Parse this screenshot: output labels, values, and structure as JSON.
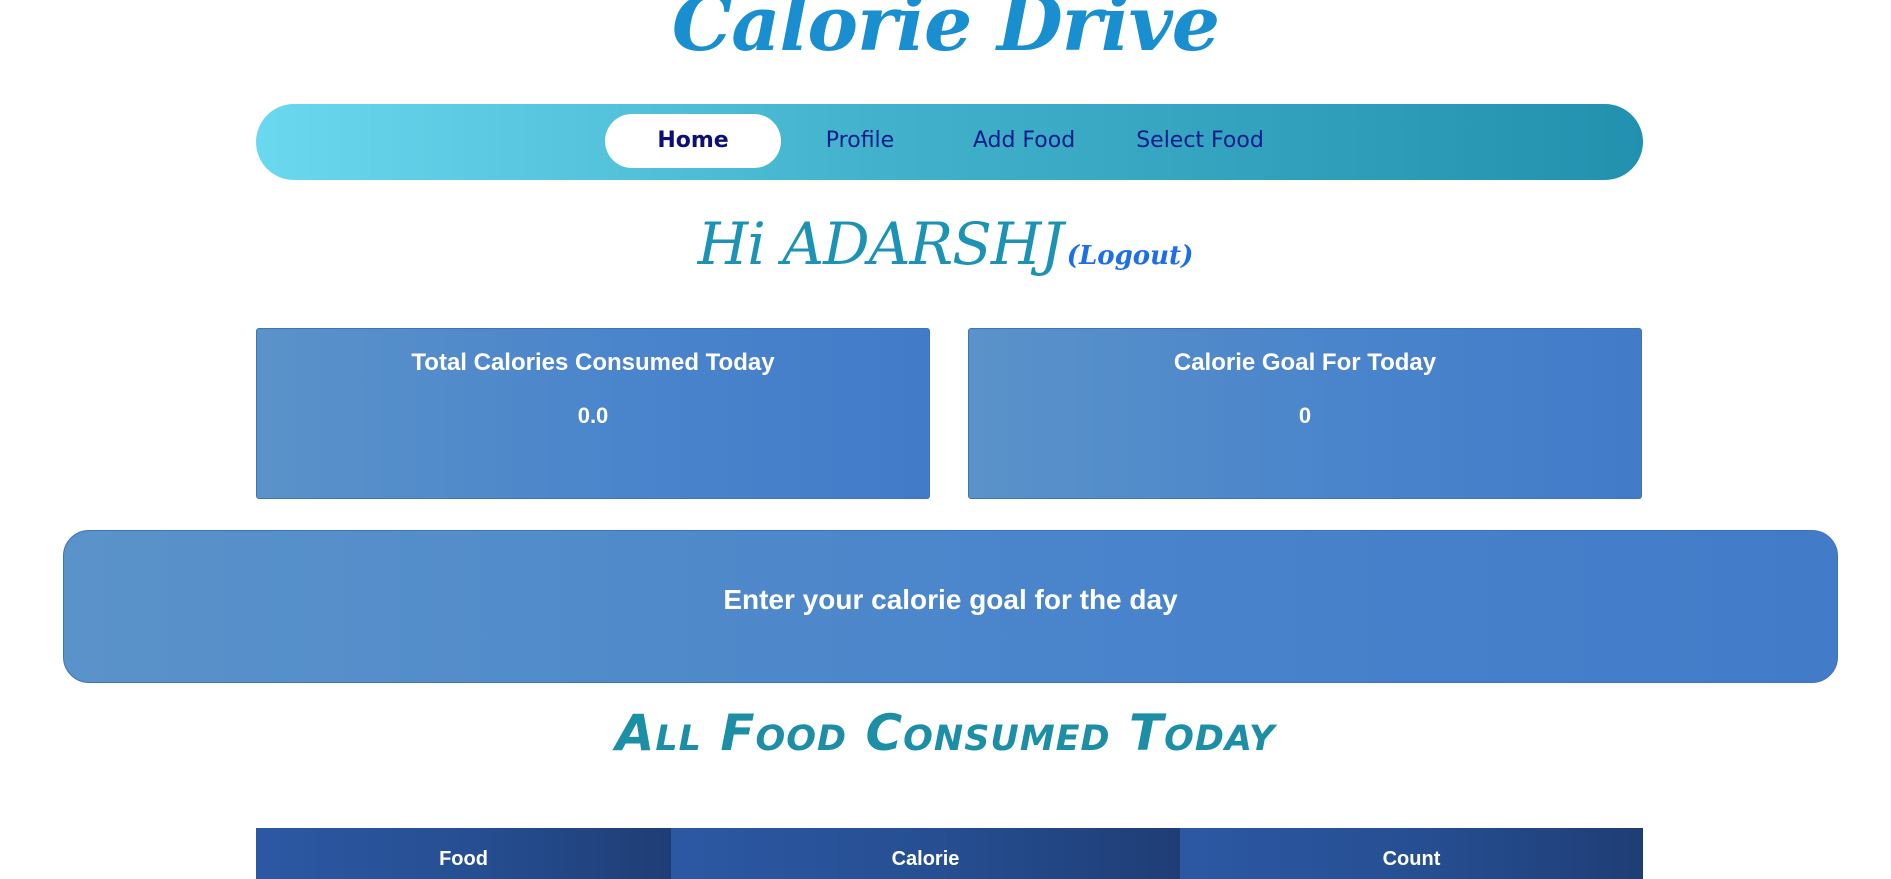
{
  "app": {
    "title": "Calorie Drive"
  },
  "nav": {
    "items": [
      {
        "label": "Home",
        "active": true
      },
      {
        "label": "Profile",
        "active": false
      },
      {
        "label": "Add Food",
        "active": false
      },
      {
        "label": "Select Food",
        "active": false
      }
    ]
  },
  "greeting": {
    "text": "Hi ADARSHJ",
    "logout_label": "(Logout)"
  },
  "cards": {
    "consumed": {
      "title": "Total Calories Consumed Today",
      "value": "0.0"
    },
    "goal": {
      "title": "Calorie Goal For Today",
      "value": "0"
    }
  },
  "goal_input": {
    "label": "Enter your calorie goal for the day"
  },
  "food_section": {
    "title": "All Food Consumed Today",
    "columns": [
      "Food",
      "Calorie",
      "Count"
    ]
  },
  "colors": {
    "title_blue": "#1a8fd0",
    "nav_gradient_start": "#6ad8ee",
    "nav_gradient_end": "#2191af",
    "card_blue": "#4a84cb",
    "table_header_blue": "#264f93"
  }
}
